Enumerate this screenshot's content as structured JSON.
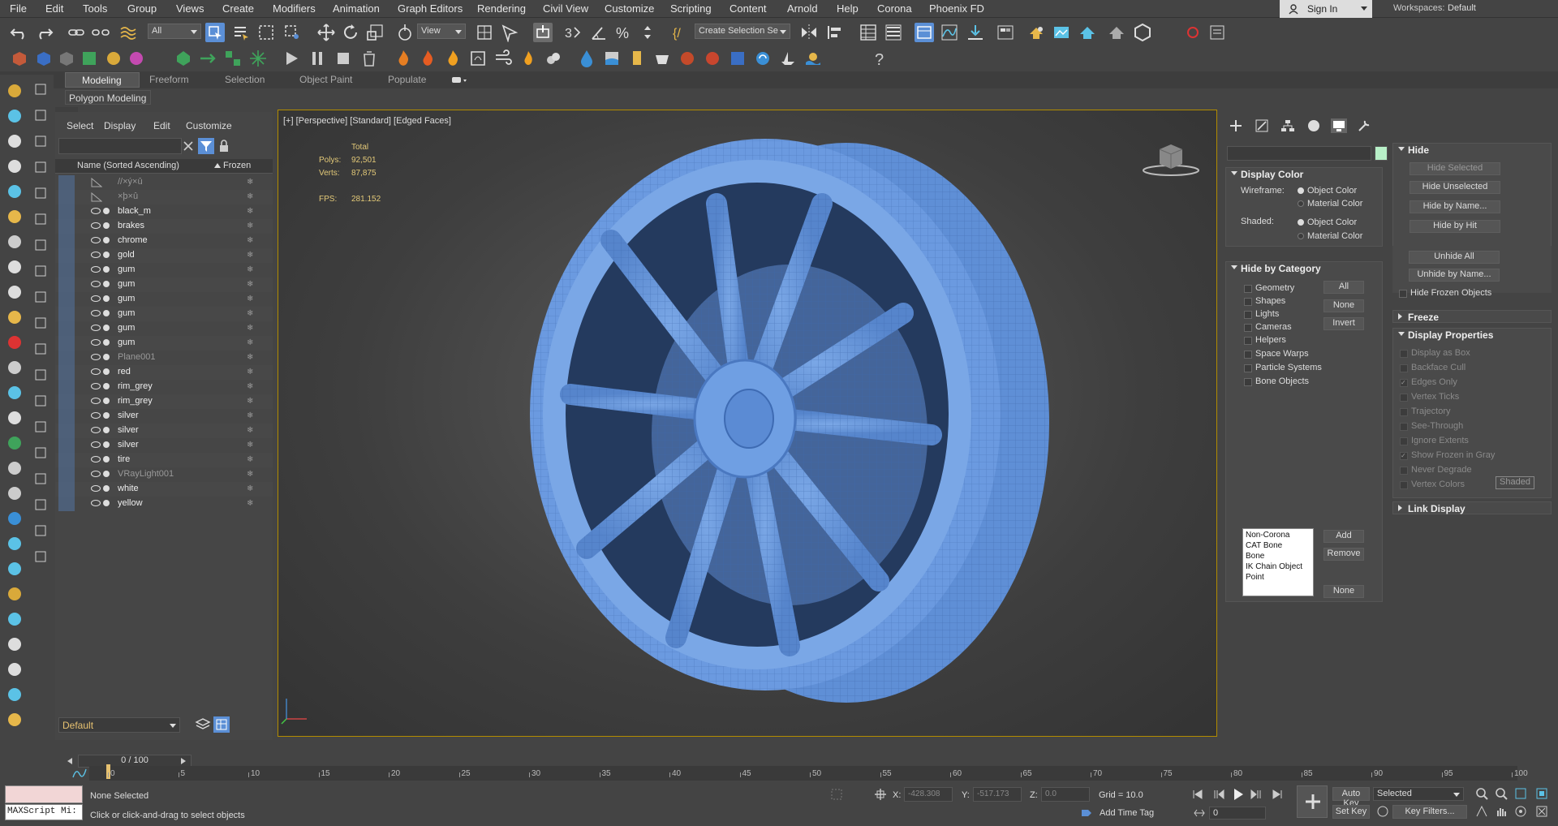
{
  "menubar": {
    "items": [
      "File",
      "Edit",
      "Tools",
      "Group",
      "Views",
      "Create",
      "Modifiers",
      "Animation",
      "Graph Editors",
      "Rendering",
      "Civil View",
      "Customize",
      "Scripting",
      "Content",
      "Arnold",
      "Help",
      "Corona",
      "Phoenix FD"
    ],
    "signin": "Sign In",
    "workspaces_label": "Workspaces:",
    "workspaces_value": "Default"
  },
  "toolbar": {
    "filter_value": "All",
    "view_value": "View",
    "create_selection_set": "Create Selection Se"
  },
  "ribbon": {
    "tabs": [
      "Modeling",
      "Freeform",
      "Selection",
      "Object Paint",
      "Populate"
    ],
    "panel_label": "Polygon Modeling"
  },
  "explorer": {
    "menus": [
      "Select",
      "Display",
      "Edit",
      "Customize"
    ],
    "col_name": "Name (Sorted Ascending)",
    "col_frozen": "Frozen",
    "rows": [
      {
        "name": "//×ý×û",
        "dim": true,
        "icon": "helper"
      },
      {
        "name": "×þ×û",
        "dim": true,
        "icon": "helper"
      },
      {
        "name": "black_m"
      },
      {
        "name": "brakes"
      },
      {
        "name": "chrome"
      },
      {
        "name": "gold"
      },
      {
        "name": "gum"
      },
      {
        "name": "gum"
      },
      {
        "name": "gum"
      },
      {
        "name": "gum"
      },
      {
        "name": "gum"
      },
      {
        "name": "gum"
      },
      {
        "name": "Plane001",
        "dim": true
      },
      {
        "name": "red"
      },
      {
        "name": "rim_grey"
      },
      {
        "name": "rim_grey"
      },
      {
        "name": "silver"
      },
      {
        "name": "silver"
      },
      {
        "name": "silver"
      },
      {
        "name": "tire"
      },
      {
        "name": "VRayLight001",
        "dim": true
      },
      {
        "name": "white"
      },
      {
        "name": "yellow"
      }
    ],
    "layer": "Default",
    "frame_range": "0 / 100"
  },
  "viewport": {
    "label": "[+] [Perspective] [Standard] [Edged Faces]",
    "stats": {
      "total": "Total",
      "polys_label": "Polys:",
      "polys": "92,501",
      "verts_label": "Verts:",
      "verts": "87,875",
      "fps_label": "FPS:",
      "fps": "281.152"
    }
  },
  "cmdpanel": {
    "display_color": {
      "title": "Display Color",
      "wireframe": "Wireframe:",
      "shaded": "Shaded:",
      "object_color": "Object Color",
      "material_color": "Material Color"
    },
    "hide_by_category": {
      "title": "Hide by Category",
      "items": [
        "Geometry",
        "Shapes",
        "Lights",
        "Cameras",
        "Helpers",
        "Space Warps",
        "Particle Systems",
        "Bone Objects"
      ],
      "btn_all": "All",
      "btn_none": "None",
      "btn_invert": "Invert",
      "list": [
        "Non-Corona",
        "CAT Bone",
        "Bone",
        "IK Chain Object",
        "Point"
      ],
      "btn_add": "Add",
      "btn_remove": "Remove",
      "btn_none2": "None"
    },
    "hide": {
      "title": "Hide",
      "buttons": [
        "Hide Selected",
        "Hide Unselected",
        "Hide by Name...",
        "Hide by Hit",
        "Unhide All",
        "Unhide by Name..."
      ],
      "hide_frozen": "Hide Frozen Objects"
    },
    "freeze": {
      "title": "Freeze"
    },
    "display_properties": {
      "title": "Display Properties",
      "items": [
        "Display as Box",
        "Backface Cull",
        "Edges Only",
        "Vertex Ticks",
        "Trajectory",
        "See-Through",
        "Ignore Extents",
        "Show Frozen in Gray",
        "Never Degrade",
        "Vertex Colors"
      ],
      "shaded_btn": "Shaded"
    },
    "link_display": {
      "title": "Link Display"
    }
  },
  "timeline": {
    "ticks": [
      "0",
      "5",
      "10",
      "15",
      "20",
      "25",
      "30",
      "35",
      "40",
      "45",
      "50",
      "55",
      "60",
      "65",
      "70",
      "75",
      "80",
      "85",
      "90",
      "95",
      "100"
    ]
  },
  "status": {
    "maxscript": "MAXScript Mi:",
    "selection": "None Selected",
    "prompt": "Click or click-and-drag to select objects",
    "x_label": "X:",
    "x": "-428.308",
    "y_label": "Y:",
    "y": "-517.173",
    "z_label": "Z:",
    "z": "0.0",
    "grid": "Grid = 10.0",
    "add_time_tag": "Add Time Tag",
    "auto_key": "Auto Key",
    "set_key": "Set Key",
    "selected": "Selected",
    "key_filters": "Key Filters...",
    "frame": "0"
  },
  "colors": {
    "accent": "#5b8fd6",
    "viewport_border": "#b28c00",
    "wheel": "#6a98db",
    "stats_text": "#e3c978"
  }
}
